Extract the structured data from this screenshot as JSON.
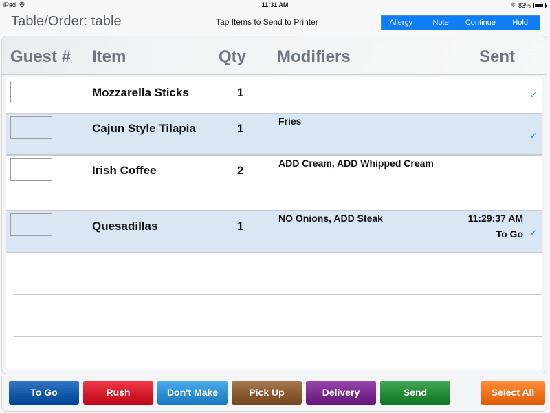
{
  "status_bar": {
    "device": "iPad",
    "time": "11:31 AM",
    "battery_percent": "83%",
    "battery_level": 0.83
  },
  "header": {
    "title": "Table/Order: table",
    "instruction": "Tap Items to Send to Printer",
    "segments": [
      {
        "label": "Allergy"
      },
      {
        "label": "Note"
      },
      {
        "label": "Continue"
      },
      {
        "label": "Hold"
      }
    ]
  },
  "table": {
    "columns": {
      "guest": "Guest #",
      "item": "Item",
      "qty": "Qty",
      "modifiers": "Modifiers",
      "sent": "Sent"
    },
    "rows": [
      {
        "guest": "",
        "item": "Mozzarella Sticks",
        "qty": "1",
        "modifiers": "",
        "sent_time": "",
        "sent_note": "",
        "sent": true,
        "selected": false
      },
      {
        "guest": "",
        "item": "Cajun Style Tilapia",
        "qty": "1",
        "modifiers": "Fries",
        "sent_time": "",
        "sent_note": "",
        "sent": true,
        "selected": true
      },
      {
        "guest": "",
        "item": "Irish Coffee",
        "qty": "2",
        "modifiers": "ADD Cream, ADD Whipped Cream",
        "sent_time": "",
        "sent_note": "",
        "sent": false,
        "selected": false
      },
      {
        "guest": "",
        "item": "Quesadillas",
        "qty": "1",
        "modifiers": "NO Onions, ADD Steak",
        "sent_time": "11:29:37 AM",
        "sent_note": "To Go",
        "sent": true,
        "selected": true
      }
    ],
    "check_glyph": "✓"
  },
  "toolbar": {
    "buttons": [
      {
        "label": "To Go",
        "color": "#1459a8"
      },
      {
        "label": "Rush",
        "color": "#d21c2c"
      },
      {
        "label": "Don't Make",
        "color": "#2d8fd2"
      },
      {
        "label": "Pick Up",
        "color": "#8a5a30"
      },
      {
        "label": "Delivery",
        "color": "#7a2a8e"
      },
      {
        "label": "Send",
        "color": "#248a35"
      },
      {
        "label": "Select All",
        "color": "#f0701c"
      }
    ]
  }
}
